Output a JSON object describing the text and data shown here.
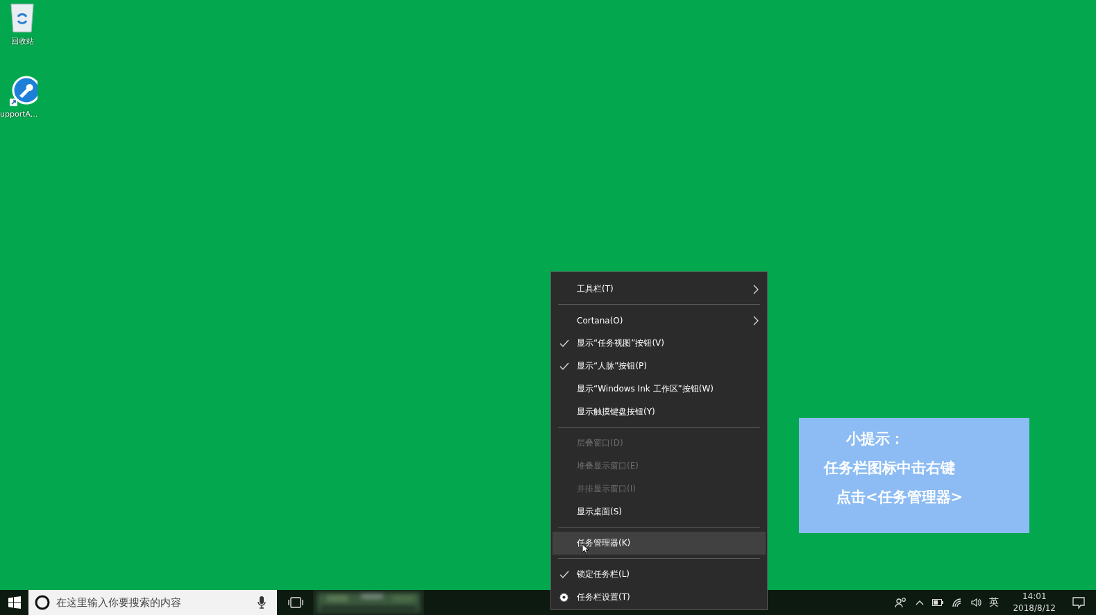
{
  "desktop": {
    "icons": [
      {
        "kind": "recycle-bin",
        "label": "回收站"
      },
      {
        "kind": "shortcut",
        "label": "upportA..."
      }
    ]
  },
  "context_menu": {
    "items": [
      {
        "kind": "item",
        "label": "工具栏(T)",
        "checked": false,
        "disabled": false,
        "submenu": true,
        "highlighted": false
      },
      {
        "kind": "separator"
      },
      {
        "kind": "item",
        "label": "Cortana(O)",
        "checked": false,
        "disabled": false,
        "submenu": true,
        "highlighted": false
      },
      {
        "kind": "item",
        "label": "显示“任务视图”按钮(V)",
        "checked": true,
        "disabled": false,
        "submenu": false,
        "highlighted": false
      },
      {
        "kind": "item",
        "label": "显示“人脉”按钮(P)",
        "checked": true,
        "disabled": false,
        "submenu": false,
        "highlighted": false
      },
      {
        "kind": "item",
        "label": "显示“Windows Ink 工作区”按钮(W)",
        "checked": false,
        "disabled": false,
        "submenu": false,
        "highlighted": false
      },
      {
        "kind": "item",
        "label": "显示触摸键盘按钮(Y)",
        "checked": false,
        "disabled": false,
        "submenu": false,
        "highlighted": false
      },
      {
        "kind": "separator"
      },
      {
        "kind": "item",
        "label": "层叠窗口(D)",
        "checked": false,
        "disabled": true,
        "submenu": false,
        "highlighted": false
      },
      {
        "kind": "item",
        "label": "堆叠显示窗口(E)",
        "checked": false,
        "disabled": true,
        "submenu": false,
        "highlighted": false
      },
      {
        "kind": "item",
        "label": "并排显示窗口(I)",
        "checked": false,
        "disabled": true,
        "submenu": false,
        "highlighted": false
      },
      {
        "kind": "item",
        "label": "显示桌面(S)",
        "checked": false,
        "disabled": false,
        "submenu": false,
        "highlighted": false
      },
      {
        "kind": "separator"
      },
      {
        "kind": "item",
        "label": "任务管理器(K)",
        "checked": false,
        "disabled": false,
        "submenu": false,
        "highlighted": true
      },
      {
        "kind": "separator"
      },
      {
        "kind": "item",
        "label": "锁定任务栏(L)",
        "checked": true,
        "disabled": false,
        "submenu": false,
        "highlighted": false
      },
      {
        "kind": "settings",
        "label": "任务栏设置(T)",
        "checked": false,
        "disabled": false,
        "submenu": false,
        "highlighted": false
      }
    ]
  },
  "tip": {
    "title": "小提示：",
    "lines": [
      "任务栏图标中击右键",
      "点击<任务管理器>"
    ]
  },
  "taskbar": {
    "search": {
      "placeholder": "在这里输入你要搜索的内容"
    },
    "input_method": "英",
    "time": "14:01",
    "date": "2018/8/12"
  }
}
